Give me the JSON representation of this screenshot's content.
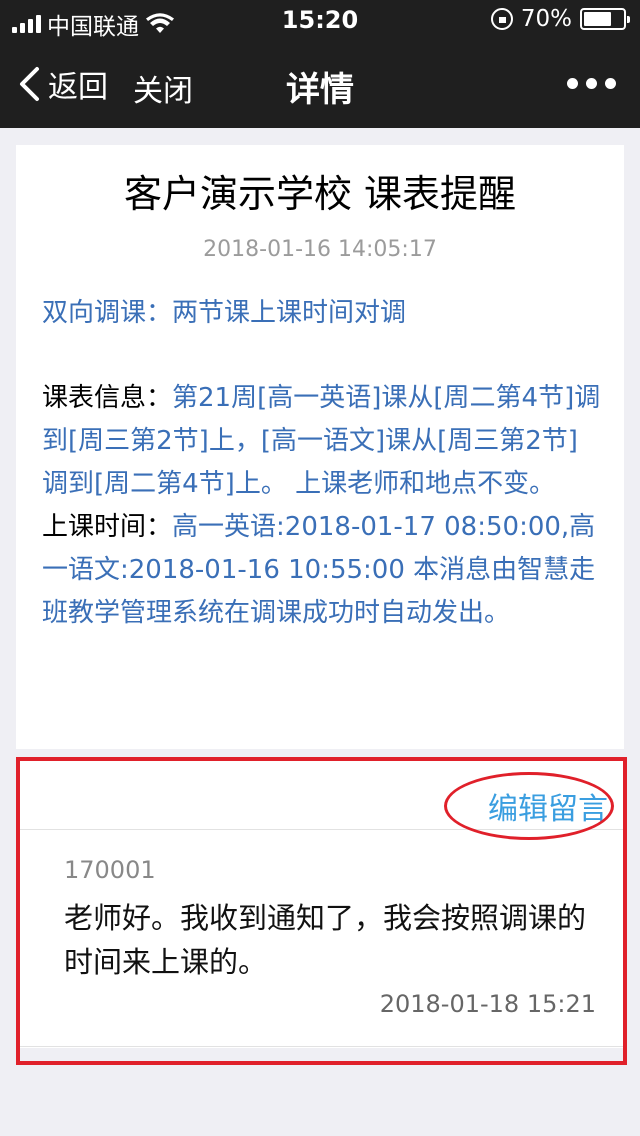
{
  "status_bar": {
    "carrier": "中国联通",
    "time": "15:20",
    "battery_text": "70%",
    "battery_level": 0.7
  },
  "nav": {
    "back_label": "返回",
    "close_label": "关闭",
    "title": "详情"
  },
  "article": {
    "title": "客户演示学校 课表提醒",
    "datetime": "2018-01-16 14:05:17",
    "summary": "双向调课：两节课上课时间对调",
    "schedule_label": "课表信息：",
    "schedule_text": "第21周[高一英语]课从[周二第4节]调到[周三第2节]上，[高一语文]课从[周三第2节]调到[周二第4节]上。 上课老师和地点不变。",
    "time_label": "上课时间：",
    "time_text": "高一英语:2018-01-17 08:50:00,高一语文:2018-01-16 10:55:00 本消息由智慧走班教学管理系统在调课成功时自动发出。"
  },
  "comments": {
    "edit_label": "编辑留言",
    "items": [
      {
        "user_id": "170001",
        "message": "老师好。我收到通知了，我会按照调课的时间来上课的。",
        "time": "2018-01-18 15:21"
      }
    ]
  },
  "colors": {
    "link_blue": "#3a6fb7",
    "edit_blue": "#3a9ee0",
    "annotation_red": "#e0202a",
    "topbar": "#1f1f1f"
  }
}
